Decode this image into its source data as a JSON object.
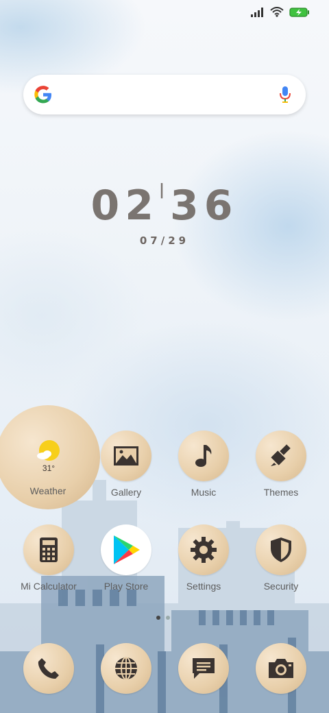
{
  "status_bar": {
    "signal_icon": "signal-icon",
    "wifi_icon": "wifi-icon",
    "battery_icon": "battery-charging-icon"
  },
  "search": {
    "logo": "google-g-icon",
    "mic": "mic-icon"
  },
  "clock": {
    "h1": "0",
    "h2": "2",
    "m1": "3",
    "m2": "6",
    "date": "07/29"
  },
  "weather": {
    "temp": "31°",
    "label": "Weather"
  },
  "apps_row1": [
    {
      "label": "Gallery",
      "icon": "image-icon"
    },
    {
      "label": "Music",
      "icon": "music-note-icon"
    },
    {
      "label": "Themes",
      "icon": "paintbrush-icon"
    }
  ],
  "apps_row2": [
    {
      "label": "Mi Calculator",
      "icon": "calculator-icon"
    },
    {
      "label": "Play Store",
      "icon": "play-store-icon"
    },
    {
      "label": "Settings",
      "icon": "gear-icon"
    },
    {
      "label": "Security",
      "icon": "shield-icon"
    }
  ],
  "dock": [
    {
      "icon": "phone-icon"
    },
    {
      "icon": "globe-icon"
    },
    {
      "icon": "message-icon"
    },
    {
      "icon": "camera-icon"
    }
  ],
  "pages": {
    "count": 2,
    "active": 1
  },
  "colors": {
    "icon_bg": "#e8cfaa",
    "icon_glyph": "#3a3330",
    "clock": "#7a7470"
  }
}
